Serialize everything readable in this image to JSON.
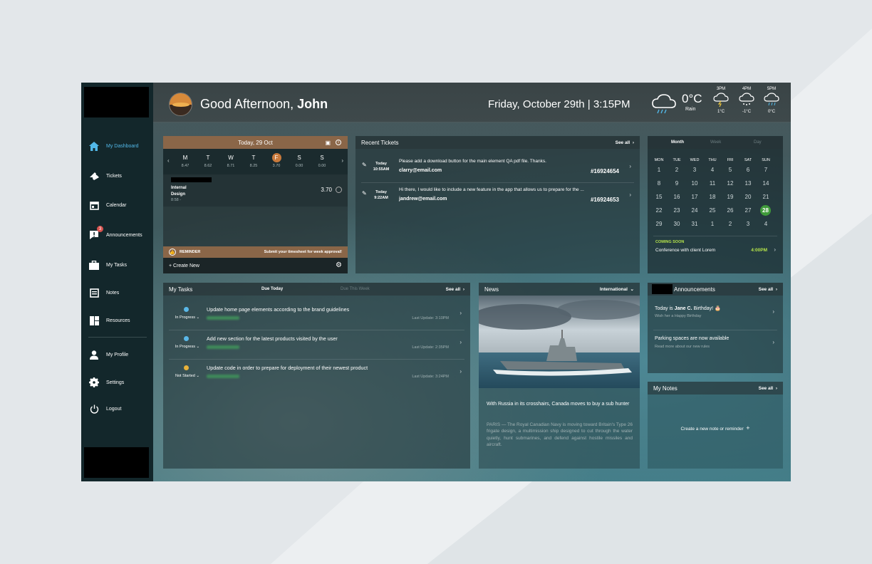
{
  "header": {
    "greeting": "Good Afternoon, ",
    "user": "John",
    "datetime": "Friday, October 29th | 3:15PM",
    "weather": {
      "temp": "0°C",
      "cond": "Rain",
      "forecast": [
        {
          "time": "3PM",
          "temp": "1°C"
        },
        {
          "time": "4PM",
          "temp": "-1°C"
        },
        {
          "time": "5PM",
          "temp": "0°C"
        }
      ]
    }
  },
  "sidebar": {
    "items": [
      {
        "label": "My Dashboard",
        "icon": "home-icon"
      },
      {
        "label": "Tickets",
        "icon": "ticket-icon"
      },
      {
        "label": "Calendar",
        "icon": "calendar-icon"
      },
      {
        "label": "Announcements",
        "icon": "announcement-icon",
        "badge": "3"
      },
      {
        "label": "My Tasks",
        "icon": "briefcase-icon"
      },
      {
        "label": "Notes",
        "icon": "notes-icon"
      },
      {
        "label": "Resources",
        "icon": "resources-icon"
      },
      {
        "label": "My Profile",
        "icon": "profile-icon"
      },
      {
        "label": "Settings",
        "icon": "gear-icon"
      },
      {
        "label": "Logout",
        "icon": "power-icon"
      }
    ]
  },
  "timesheet": {
    "title": "Today, 29 Oct",
    "days": [
      {
        "d": "M",
        "v": "8.47"
      },
      {
        "d": "T",
        "v": "8.62"
      },
      {
        "d": "W",
        "v": "8.71"
      },
      {
        "d": "T",
        "v": "8.25"
      },
      {
        "d": "F",
        "v": "3.70"
      },
      {
        "d": "S",
        "v": "0.00"
      },
      {
        "d": "S",
        "v": "0.00"
      }
    ],
    "entry": {
      "name1": "Internal",
      "name2": "Design",
      "time": "8:58 -",
      "hours": "3.70"
    },
    "reminder_label": "REMINDER",
    "reminder_text": "Submit your timesheet for week approval!",
    "create": "+ Create New"
  },
  "tickets": {
    "title": "Recent Tickets",
    "seeall": "See all",
    "items": [
      {
        "day": "Today",
        "time": "10:55AM",
        "text": "Please add a download button for the main element QA pdf file. Thanks.",
        "email": "clarry@email.com",
        "id": "#16924654"
      },
      {
        "day": "Today",
        "time": "9:22AM",
        "text": "Hi there, I would like to include a new feature in the app that allows us to prepare for the ...",
        "email": "jandrew@email.com",
        "id": "#16924653"
      }
    ]
  },
  "calendar": {
    "tabs": [
      "Month",
      "Week",
      "Day"
    ],
    "weekdays": [
      "MON",
      "TUE",
      "WED",
      "THU",
      "FRI",
      "SAT",
      "SUN"
    ],
    "days": [
      "1",
      "2",
      "3",
      "4",
      "5",
      "6",
      "7",
      "8",
      "9",
      "10",
      "11",
      "12",
      "13",
      "14",
      "15",
      "16",
      "17",
      "18",
      "19",
      "20",
      "21",
      "22",
      "23",
      "24",
      "25",
      "26",
      "27",
      "28",
      "29",
      "30",
      "31",
      "1",
      "2",
      "3",
      "4"
    ],
    "today": "28",
    "coming_label": "COMING SOON",
    "event": "Conference with client Lorem",
    "event_time": "4:00PM"
  },
  "tasks": {
    "title": "My Tasks",
    "tabs": [
      "Due Today",
      "Due This Week"
    ],
    "seeall": "See all",
    "items": [
      {
        "text": "Update home page elements according to the brand guidelines",
        "status": "In Progress",
        "update": "Last Update: 3:10PM",
        "color": "#5ab8e8"
      },
      {
        "text": "Add new section for the latest products visited by the user",
        "status": "In Progress",
        "update": "Last Update: 2:35PM",
        "color": "#5ab8e8"
      },
      {
        "text": "Update code in order to prepare for deployment of their newest product",
        "status": "Not Started",
        "update": "Last Update: 3:24PM",
        "color": "#e8b23a"
      }
    ]
  },
  "news": {
    "title": "News",
    "region": "International",
    "headline": "With Russia in its crosshairs, Canada moves to buy a sub hunter",
    "body": "PARIS — The Royal Canadian Navy is moving toward Britain's Type 26 frigate design, a multimission ship designed to cut through the water quietly, hunt submarines, and defend against hostile missiles and aircraft."
  },
  "announcements": {
    "title": "Announcements",
    "seeall": "See all",
    "items": [
      {
        "pre": "Today is ",
        "name": "Jane C.",
        "post": " Birthday!",
        "sub": "Wish her a Happy Birthday"
      },
      {
        "pre": "Parking spaces are now available",
        "name": "",
        "post": "",
        "sub": "Read more about our new rules"
      }
    ]
  },
  "notes": {
    "title": "My Notes",
    "seeall": "See all",
    "create": "Create a new note or reminder"
  }
}
